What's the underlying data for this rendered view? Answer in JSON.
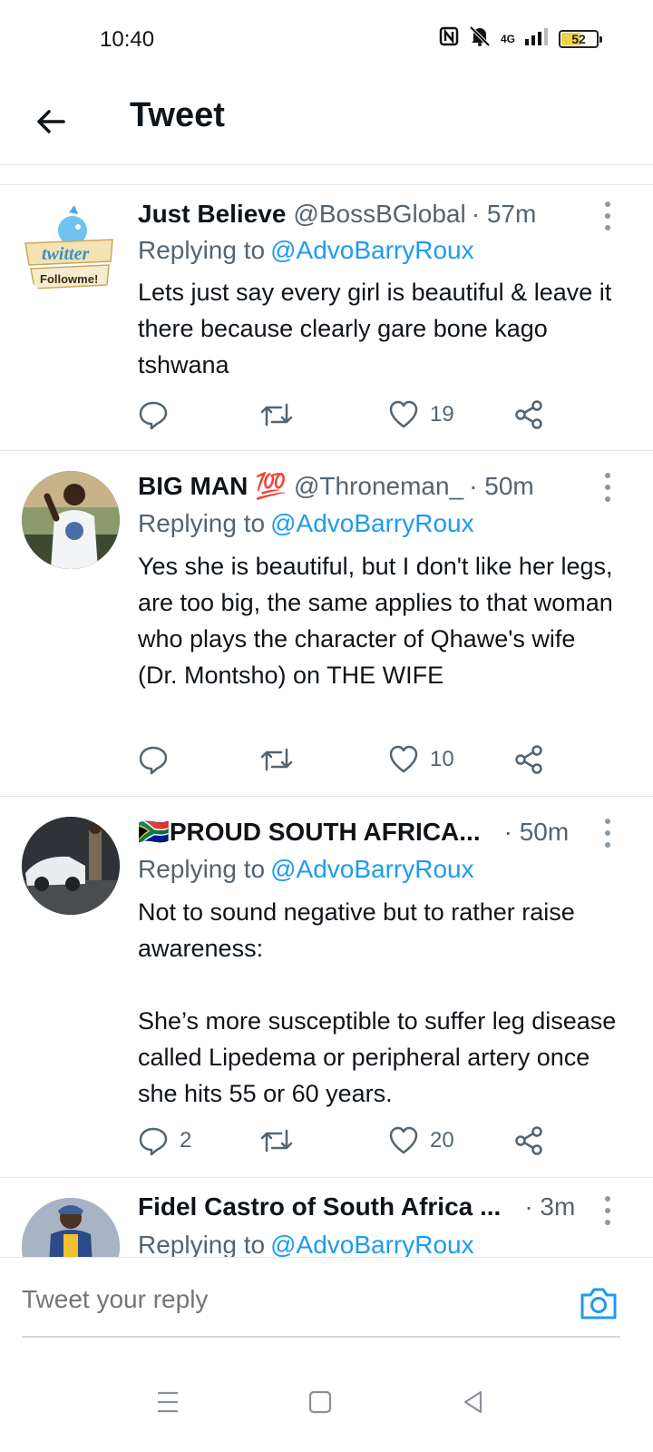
{
  "status_bar": {
    "time": "10:40",
    "network": "4G",
    "battery": "52",
    "battery_level": 0.52,
    "icons": [
      "nfc-icon",
      "mute-icon",
      "signal-icon",
      "battery-icon"
    ]
  },
  "header": {
    "back_icon": "arrow-left-icon",
    "title": "Tweet"
  },
  "tweets": [
    {
      "name": "Just Believe",
      "handle": "@BossBGlobal",
      "time": "· 57m",
      "replying_label": "Replying to",
      "replying_to": "@AdvoBarryRoux",
      "text": "Lets just say every girl is beautiful & leave it there because clearly gare bone kago tshwana",
      "reply_count": "",
      "retweet_count": "",
      "like_count": "19"
    },
    {
      "name": "BIG MAN 💯",
      "handle": "@Throneman_",
      "time": "· 50m",
      "replying_label": "Replying to",
      "replying_to": "@AdvoBarryRoux",
      "text": "Yes she is beautiful, but I don't like her legs, are too big, the same applies to that woman who plays the character of Qhawe's wife (Dr. Montsho) on THE WIFE",
      "reply_count": "",
      "retweet_count": "",
      "like_count": "10"
    },
    {
      "name": "🇿🇦PROUD SOUTH AFRICA...",
      "handle": "",
      "time": "· 50m",
      "replying_label": "Replying to",
      "replying_to": "@AdvoBarryRoux",
      "text": "Not to sound negative but to rather raise awareness:\n\nShe’s more susceptible to suffer leg disease called Lipedema or peripheral artery once she hits 55 or 60 years.",
      "reply_count": "2",
      "retweet_count": "",
      "like_count": "20"
    },
    {
      "name": "Fidel Castro of South Africa ...",
      "handle": "",
      "time": "· 3m",
      "replying_label": "Replying to",
      "replying_to": "@AdvoBarryRoux",
      "text": "",
      "reply_count": "",
      "retweet_count": "",
      "like_count": ""
    }
  ],
  "avatar_badge": {
    "line1": "twitter",
    "line2": "Followme!"
  },
  "reply_bar": {
    "placeholder": "Tweet your reply",
    "camera_icon": "camera-icon"
  },
  "nav_bar": {
    "icons": [
      "menu-icon",
      "home-square-icon",
      "back-triangle-icon"
    ]
  },
  "colors": {
    "accent": "#1d9bf0",
    "text_primary": "#0f1419",
    "text_secondary": "#536471",
    "divider": "#e1e8ed"
  }
}
